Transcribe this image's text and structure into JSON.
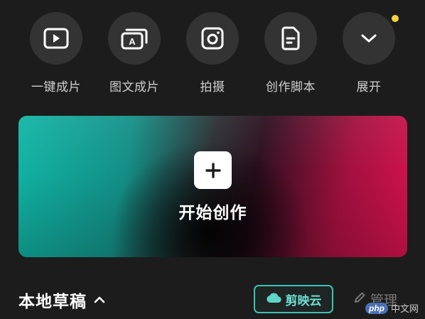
{
  "quick_actions": [
    {
      "label": "一键成片",
      "icon": "play-box-icon"
    },
    {
      "label": "图文成片",
      "icon": "text-image-stack-icon"
    },
    {
      "label": "拍摄",
      "icon": "camera-icon"
    },
    {
      "label": "创作脚本",
      "icon": "script-document-icon"
    },
    {
      "label": "展开",
      "icon": "chevron-down-icon",
      "has_notification": true
    }
  ],
  "create": {
    "label": "开始创作",
    "icon": "plus-icon"
  },
  "drafts": {
    "title": "本地草稿",
    "toggle_icon": "chevron-up-icon"
  },
  "cloud": {
    "label": "剪映云",
    "icon": "cloud-icon"
  },
  "manage": {
    "label": "管理",
    "icon": "pencil-icon"
  },
  "watermark": {
    "badge": "php",
    "text": "中文网"
  },
  "colors": {
    "background": "#1c1c1c",
    "circle": "#333333",
    "accent_teal": "#3fc2b2",
    "accent_red": "#d6124f",
    "notification": "#f3d23a"
  }
}
